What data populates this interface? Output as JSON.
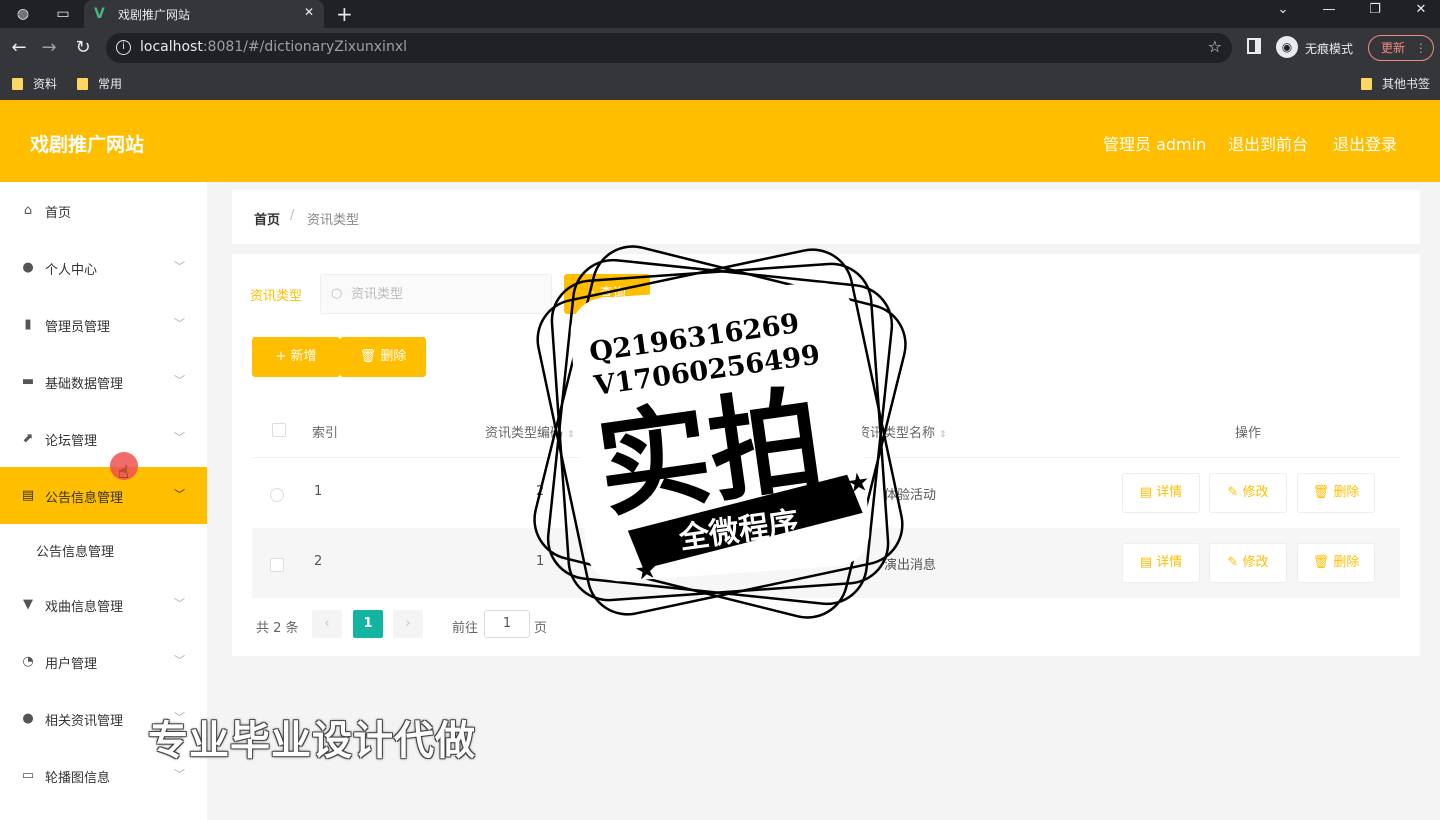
{
  "browser": {
    "tab_title": "戏剧推广网站",
    "url_host": "localhost",
    "url_rest": ":8081/#/dictionaryZixunxinxl",
    "incognito_label": "无痕模式",
    "update_label": "更新",
    "bookmarks": [
      "资料",
      "常用"
    ],
    "other_bookmarks": "其他书签"
  },
  "header": {
    "title": "戏剧推广网站",
    "user": "管理员 admin",
    "to_front": "退出到前台",
    "logout": "退出登录"
  },
  "sidebar": {
    "items": [
      {
        "label": "首页",
        "icon": "home-icon"
      },
      {
        "label": "个人中心",
        "icon": "user-icon"
      },
      {
        "label": "管理员管理",
        "icon": "bar-chart-icon"
      },
      {
        "label": "基础数据管理",
        "icon": "monitor-icon"
      },
      {
        "label": "论坛管理",
        "icon": "trend-chart-icon"
      },
      {
        "label": "公告信息管理",
        "icon": "document-icon"
      },
      {
        "label": "戏曲信息管理",
        "icon": "stand-icon"
      },
      {
        "label": "用户管理",
        "icon": "help-icon"
      },
      {
        "label": "相关资讯管理",
        "icon": "user-icon"
      },
      {
        "label": "轮播图信息",
        "icon": "suitcase-icon"
      }
    ],
    "sub_item": "公告信息管理"
  },
  "breadcrumb": {
    "home": "首页",
    "current": "资讯类型"
  },
  "search": {
    "label": "资讯类型",
    "placeholder": "资讯类型",
    "button": "查询"
  },
  "actions": {
    "add": "新增",
    "delete": "删除"
  },
  "table": {
    "headers": {
      "index": "索引",
      "code": "资讯类型编码",
      "name": "资讯类型名称",
      "ops": "操作"
    },
    "rows": [
      {
        "index": "1",
        "code": "2",
        "name": "体验活动"
      },
      {
        "index": "2",
        "code": "1",
        "name": "演出消息"
      }
    ],
    "row_actions": {
      "detail": "详情",
      "edit": "修改",
      "delete": "删除"
    }
  },
  "pagination": {
    "total": "共 2 条",
    "current_page": "1",
    "goto_prefix": "前往",
    "goto_value": "1",
    "goto_suffix": "页"
  },
  "watermark": {
    "qq": "Q2196316269",
    "wx": "V17060256499",
    "big": "实拍",
    "ribbon": "全微程序",
    "bottom": "专业毕业设计代做"
  }
}
